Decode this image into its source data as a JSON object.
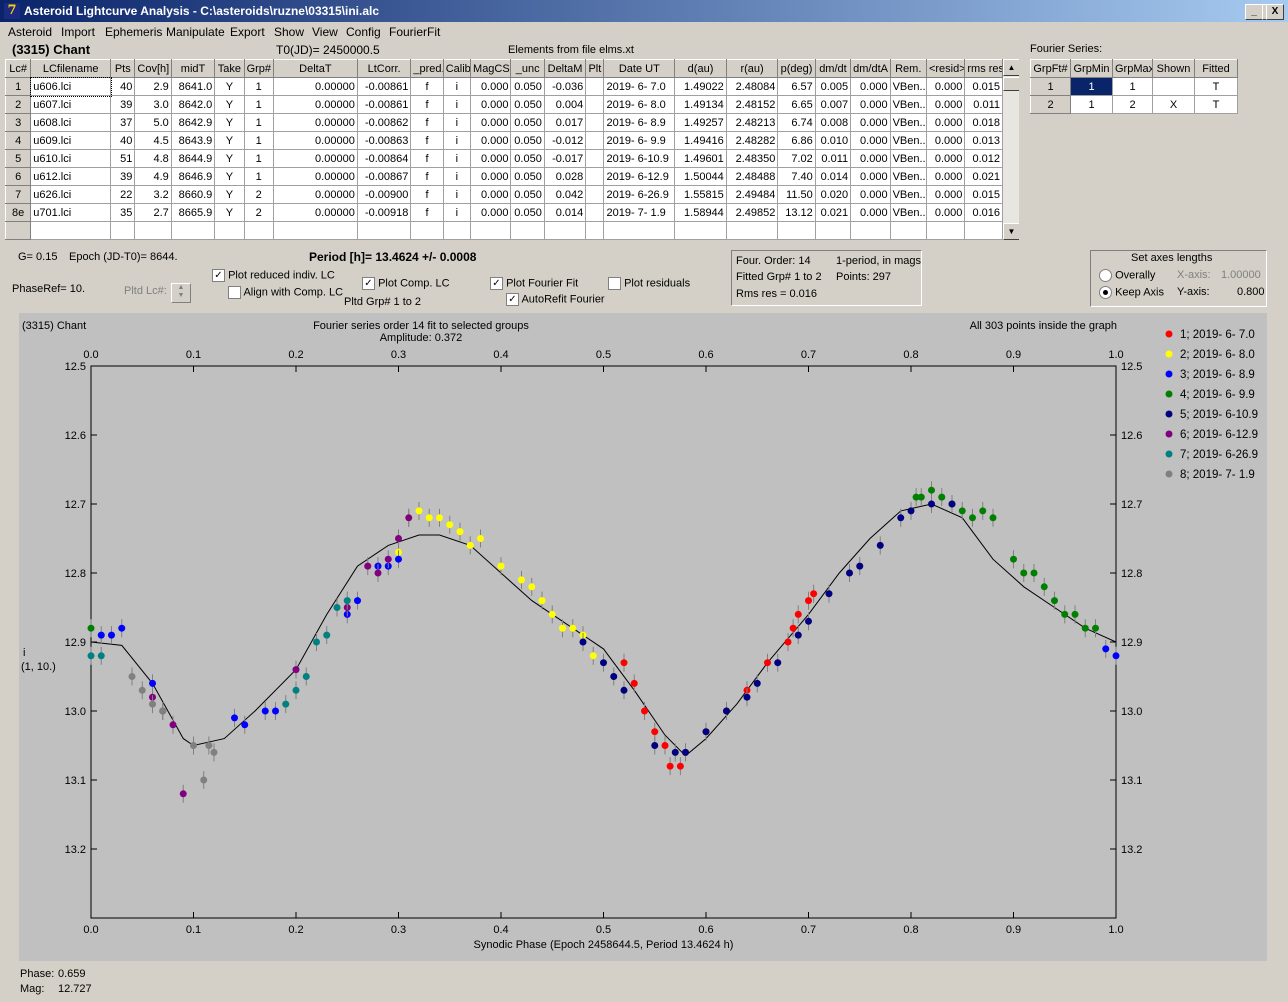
{
  "window": {
    "title": "Asteroid Lightcurve Analysis - C:\\asteroids\\ruzne\\03315\\ini.alc",
    "icon": "app-icon",
    "min": "_",
    "max": "□",
    "close": "X"
  },
  "menu": [
    "Asteroid",
    "Import",
    "Ephemeris",
    "Manipulate",
    "Export",
    "Show",
    "View",
    "Config",
    "FourierFit"
  ],
  "header": {
    "object": "(3315) Chant",
    "t0": "T0(JD)= 2450000.5",
    "elements": "Elements from file elms.xt"
  },
  "table": {
    "columns": [
      "Lc#",
      "LCfilename",
      "Pts",
      "Cov[h]",
      "midT",
      "Take",
      "Grp#",
      "DeltaT",
      "LtCorr.",
      "_pred.",
      "Calib",
      "MagCS",
      "_unc",
      "DeltaM",
      "Plt",
      "Date UT",
      "d(au)",
      "r(au)",
      "p(deg)",
      "dm/dt",
      "dm/dtA",
      "Rem.",
      "<resid>",
      "rms res"
    ],
    "rows": [
      [
        "1",
        "u606.lci",
        "40",
        "2.9",
        "8641.0",
        "Y",
        "1",
        "0.00000",
        "-0.00861",
        "f",
        "i",
        "0.000",
        "0.050",
        "-0.036",
        "",
        "2019- 6- 7.0",
        "1.49022",
        "2.48084",
        "6.57",
        "0.005",
        "0.000",
        "VBen..",
        "0.000",
        "0.015"
      ],
      [
        "2",
        "u607.lci",
        "39",
        "3.0",
        "8642.0",
        "Y",
        "1",
        "0.00000",
        "-0.00861",
        "f",
        "i",
        "0.000",
        "0.050",
        "0.004",
        "",
        "2019- 6- 8.0",
        "1.49134",
        "2.48152",
        "6.65",
        "0.007",
        "0.000",
        "VBen..",
        "0.000",
        "0.011"
      ],
      [
        "3",
        "u608.lci",
        "37",
        "5.0",
        "8642.9",
        "Y",
        "1",
        "0.00000",
        "-0.00862",
        "f",
        "i",
        "0.000",
        "0.050",
        "0.017",
        "",
        "2019- 6- 8.9",
        "1.49257",
        "2.48213",
        "6.74",
        "0.008",
        "0.000",
        "VBen..",
        "0.000",
        "0.018"
      ],
      [
        "4",
        "u609.lci",
        "40",
        "4.5",
        "8643.9",
        "Y",
        "1",
        "0.00000",
        "-0.00863",
        "f",
        "i",
        "0.000",
        "0.050",
        "-0.012",
        "",
        "2019- 6- 9.9",
        "1.49416",
        "2.48282",
        "6.86",
        "0.010",
        "0.000",
        "VBen..",
        "0.000",
        "0.013"
      ],
      [
        "5",
        "u610.lci",
        "51",
        "4.8",
        "8644.9",
        "Y",
        "1",
        "0.00000",
        "-0.00864",
        "f",
        "i",
        "0.000",
        "0.050",
        "-0.017",
        "",
        "2019- 6-10.9",
        "1.49601",
        "2.48350",
        "7.02",
        "0.011",
        "0.000",
        "VBen..",
        "0.000",
        "0.012"
      ],
      [
        "6",
        "u612.lci",
        "39",
        "4.9",
        "8646.9",
        "Y",
        "1",
        "0.00000",
        "-0.00867",
        "f",
        "i",
        "0.000",
        "0.050",
        "0.028",
        "",
        "2019- 6-12.9",
        "1.50044",
        "2.48488",
        "7.40",
        "0.014",
        "0.000",
        "VBen..",
        "0.000",
        "0.021"
      ],
      [
        "7",
        "u626.lci",
        "22",
        "3.2",
        "8660.9",
        "Y",
        "2",
        "0.00000",
        "-0.00900",
        "f",
        "i",
        "0.000",
        "0.050",
        "0.042",
        "",
        "2019- 6-26.9",
        "1.55815",
        "2.49484",
        "11.50",
        "0.020",
        "0.000",
        "VBen..",
        "0.000",
        "0.015"
      ],
      [
        "8e",
        "u701.lci",
        "35",
        "2.7",
        "8665.9",
        "Y",
        "2",
        "0.00000",
        "-0.00918",
        "f",
        "i",
        "0.000",
        "0.050",
        "0.014",
        "",
        "2019- 7- 1.9",
        "1.58944",
        "2.49852",
        "13.12",
        "0.021",
        "0.000",
        "VBen..",
        "0.000",
        "0.016"
      ]
    ]
  },
  "fourier_table": {
    "label": "Fourier Series:",
    "columns": [
      "GrpFt#",
      "GrpMin",
      "GrpMax",
      "Shown",
      "Fitted"
    ],
    "rows": [
      [
        "1",
        "1",
        "1",
        "",
        "T"
      ],
      [
        "2",
        "1",
        "2",
        "X",
        "T"
      ]
    ]
  },
  "controls": {
    "g_label": "G= 0.15",
    "epoch": "Epoch (JD-T0)= 8644.",
    "period": "Period [h]= 13.4624 +/- 0.0008",
    "phaseref": "PhaseRef= 10.",
    "pltd_lc": "Pltd Lc#:",
    "plot_reduced": "Plot reduced indiv. LC",
    "align": "Align with Comp. LC",
    "plot_comp": "Plot Comp. LC",
    "pltd_grp": "Pltd Grp#  1   to   2",
    "plot_fourier": "Plot Fourier Fit",
    "autorefit": "AutoRefit Fourier",
    "plot_resid": "Plot residuals",
    "four_order": "Four. Order: 14",
    "one_period": "1-period, in mags",
    "fitted_grp": "Fitted Grp# 1 to 2",
    "points": "Points: 297",
    "rms": "Rms res     = 0.016",
    "axes_title": "Set axes lengths",
    "overally": "Overally",
    "keep_axis": "Keep Axis",
    "xaxis_label": "X-axis:",
    "xaxis_val": "1.00000",
    "yaxis_label": "Y-axis:",
    "yaxis_val": "0.800"
  },
  "chart_data": {
    "type": "scatter",
    "object_label": "(3315) Chant",
    "title": "Fourier series order 14 fit to selected groups",
    "subtitle": "Amplitude: 0.372",
    "note": "All 303 points inside the graph",
    "xlabel": "Synodic Phase (Epoch 2458644.5, Period 13.4624 h)",
    "ylabel": "i",
    "ylabel2": "(1, 10.)",
    "xlim": [
      0,
      1
    ],
    "ylim": [
      12.5,
      13.3
    ],
    "y_inverted": true,
    "x_ticks": [
      "0.0",
      "0.1",
      "0.2",
      "0.3",
      "0.4",
      "0.5",
      "0.6",
      "0.7",
      "0.8",
      "0.9",
      "1.0"
    ],
    "y_ticks": [
      "12.5",
      "12.6",
      "12.7",
      "12.8",
      "12.9",
      "13.0",
      "13.1",
      "13.2"
    ],
    "fourier_curve": {
      "x": [
        0,
        0.03,
        0.06,
        0.09,
        0.1,
        0.13,
        0.16,
        0.2,
        0.23,
        0.26,
        0.29,
        0.32,
        0.34,
        0.37,
        0.4,
        0.43,
        0.46,
        0.5,
        0.53,
        0.56,
        0.58,
        0.6,
        0.63,
        0.66,
        0.7,
        0.73,
        0.76,
        0.79,
        0.82,
        0.85,
        0.88,
        0.91,
        0.94,
        0.97,
        1.0
      ],
      "y": [
        12.9,
        12.905,
        12.96,
        13.04,
        13.05,
        13.04,
        13.0,
        12.94,
        12.86,
        12.79,
        12.76,
        12.745,
        12.745,
        12.76,
        12.8,
        12.84,
        12.87,
        12.91,
        12.97,
        13.035,
        13.065,
        13.04,
        12.99,
        12.93,
        12.86,
        12.8,
        12.75,
        12.71,
        12.7,
        12.72,
        12.78,
        12.82,
        12.85,
        12.88,
        12.9
      ]
    },
    "series": [
      {
        "name": "1; 2019- 6- 7.0",
        "color": "#ff0000",
        "x": [
          0.52,
          0.53,
          0.54,
          0.55,
          0.56,
          0.565,
          0.575,
          0.58,
          0.6,
          0.62,
          0.64,
          0.66,
          0.68,
          0.685,
          0.69,
          0.7,
          0.705
        ],
        "y": [
          12.93,
          12.96,
          13.0,
          13.03,
          13.05,
          13.08,
          13.08,
          13.06,
          13.03,
          13.0,
          12.97,
          12.93,
          12.9,
          12.88,
          12.86,
          12.84,
          12.83
        ]
      },
      {
        "name": "2; 2019- 6- 8.0",
        "color": "#ffff00",
        "x": [
          0.3,
          0.31,
          0.32,
          0.33,
          0.34,
          0.35,
          0.36,
          0.37,
          0.38,
          0.4,
          0.42,
          0.43,
          0.44,
          0.45,
          0.46,
          0.47,
          0.48,
          0.49
        ],
        "y": [
          12.77,
          12.72,
          12.71,
          12.72,
          12.72,
          12.73,
          12.74,
          12.76,
          12.75,
          12.79,
          12.81,
          12.82,
          12.84,
          12.86,
          12.88,
          12.88,
          12.89,
          12.92
        ]
      },
      {
        "name": "3; 2019- 6- 8.9",
        "color": "#0000ff",
        "x": [
          0.01,
          0.02,
          0.03,
          0.06,
          0.14,
          0.15,
          0.17,
          0.18,
          0.25,
          0.26,
          0.28,
          0.29,
          0.3,
          0.99,
          1.0
        ],
        "y": [
          12.89,
          12.89,
          12.88,
          12.96,
          13.01,
          13.02,
          13.0,
          13.0,
          12.86,
          12.84,
          12.79,
          12.79,
          12.78,
          12.91,
          12.92
        ]
      },
      {
        "name": "4; 2019- 6- 9.9",
        "color": "#008000",
        "x": [
          0.0,
          0.805,
          0.81,
          0.82,
          0.83,
          0.84,
          0.85,
          0.86,
          0.87,
          0.88,
          0.9,
          0.91,
          0.92,
          0.93,
          0.94,
          0.95,
          0.96,
          0.97,
          0.98
        ],
        "y": [
          12.88,
          12.69,
          12.69,
          12.68,
          12.69,
          12.7,
          12.71,
          12.72,
          12.71,
          12.72,
          12.78,
          12.8,
          12.8,
          12.82,
          12.84,
          12.86,
          12.86,
          12.88,
          12.88
        ]
      },
      {
        "name": "5; 2019- 6-10.9",
        "color": "#000080",
        "x": [
          0.48,
          0.5,
          0.51,
          0.52,
          0.55,
          0.57,
          0.58,
          0.6,
          0.62,
          0.64,
          0.65,
          0.67,
          0.69,
          0.7,
          0.72,
          0.74,
          0.75,
          0.77,
          0.79,
          0.8,
          0.82,
          0.84
        ],
        "y": [
          12.9,
          12.93,
          12.95,
          12.97,
          13.05,
          13.06,
          13.06,
          13.03,
          13.0,
          12.98,
          12.96,
          12.93,
          12.89,
          12.87,
          12.83,
          12.8,
          12.79,
          12.76,
          12.72,
          12.71,
          12.7,
          12.7
        ]
      },
      {
        "name": "6; 2019- 6-12.9",
        "color": "#800080",
        "x": [
          0.06,
          0.07,
          0.08,
          0.09,
          0.2,
          0.25,
          0.27,
          0.28,
          0.29,
          0.3,
          0.31
        ],
        "y": [
          12.98,
          13.0,
          13.02,
          13.12,
          12.94,
          12.85,
          12.79,
          12.8,
          12.78,
          12.75,
          12.72
        ]
      },
      {
        "name": "7; 2019- 6-26.9",
        "color": "#008080",
        "x": [
          0.0,
          0.01,
          0.19,
          0.2,
          0.21,
          0.22,
          0.23,
          0.24,
          0.25
        ],
        "y": [
          12.92,
          12.92,
          12.99,
          12.97,
          12.95,
          12.9,
          12.89,
          12.85,
          12.84
        ]
      },
      {
        "name": "8; 2019- 7- 1.9",
        "color": "#808080",
        "x": [
          0.04,
          0.05,
          0.06,
          0.07,
          0.1,
          0.11,
          0.115,
          0.12
        ],
        "y": [
          12.95,
          12.97,
          12.99,
          13.0,
          13.05,
          13.1,
          13.05,
          13.06
        ]
      }
    ]
  },
  "status": {
    "phase_label": "Phase:",
    "phase": "0.659",
    "mag_label": "Mag:",
    "mag": "12.727"
  }
}
